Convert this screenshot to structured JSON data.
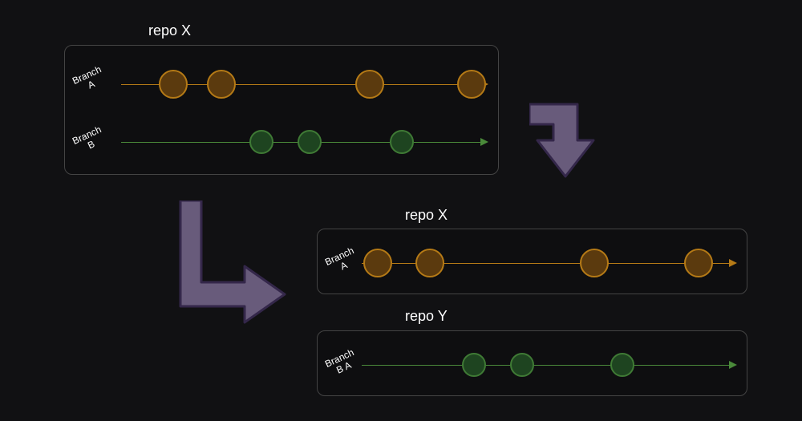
{
  "top": {
    "title": "repo X",
    "branchA_label": "Branch\nA",
    "branchB_label": "Branch\nB"
  },
  "midX": {
    "title": "repo X",
    "branchA_label": "Branch\nA"
  },
  "midY": {
    "title": "repo Y",
    "branchBA_label": "Branch\nB A"
  },
  "colors": {
    "orange_fill": "#5b3a0e",
    "orange_stroke": "#b57a16",
    "green_fill": "#1e4420",
    "green_stroke": "#3f7a35",
    "arrow_fill": "#685b7b",
    "arrow_stroke": "#34274a"
  },
  "diagram": {
    "top_box": {
      "branchA_commit_x": [
        135,
        195,
        380,
        507
      ],
      "branchB_commit_x": [
        245,
        305,
        420
      ]
    },
    "midX_box": {
      "branchA_commit_x": [
        75,
        140,
        345,
        475
      ]
    },
    "midY_box": {
      "branchBA_commit_x": [
        195,
        255,
        380
      ]
    }
  }
}
